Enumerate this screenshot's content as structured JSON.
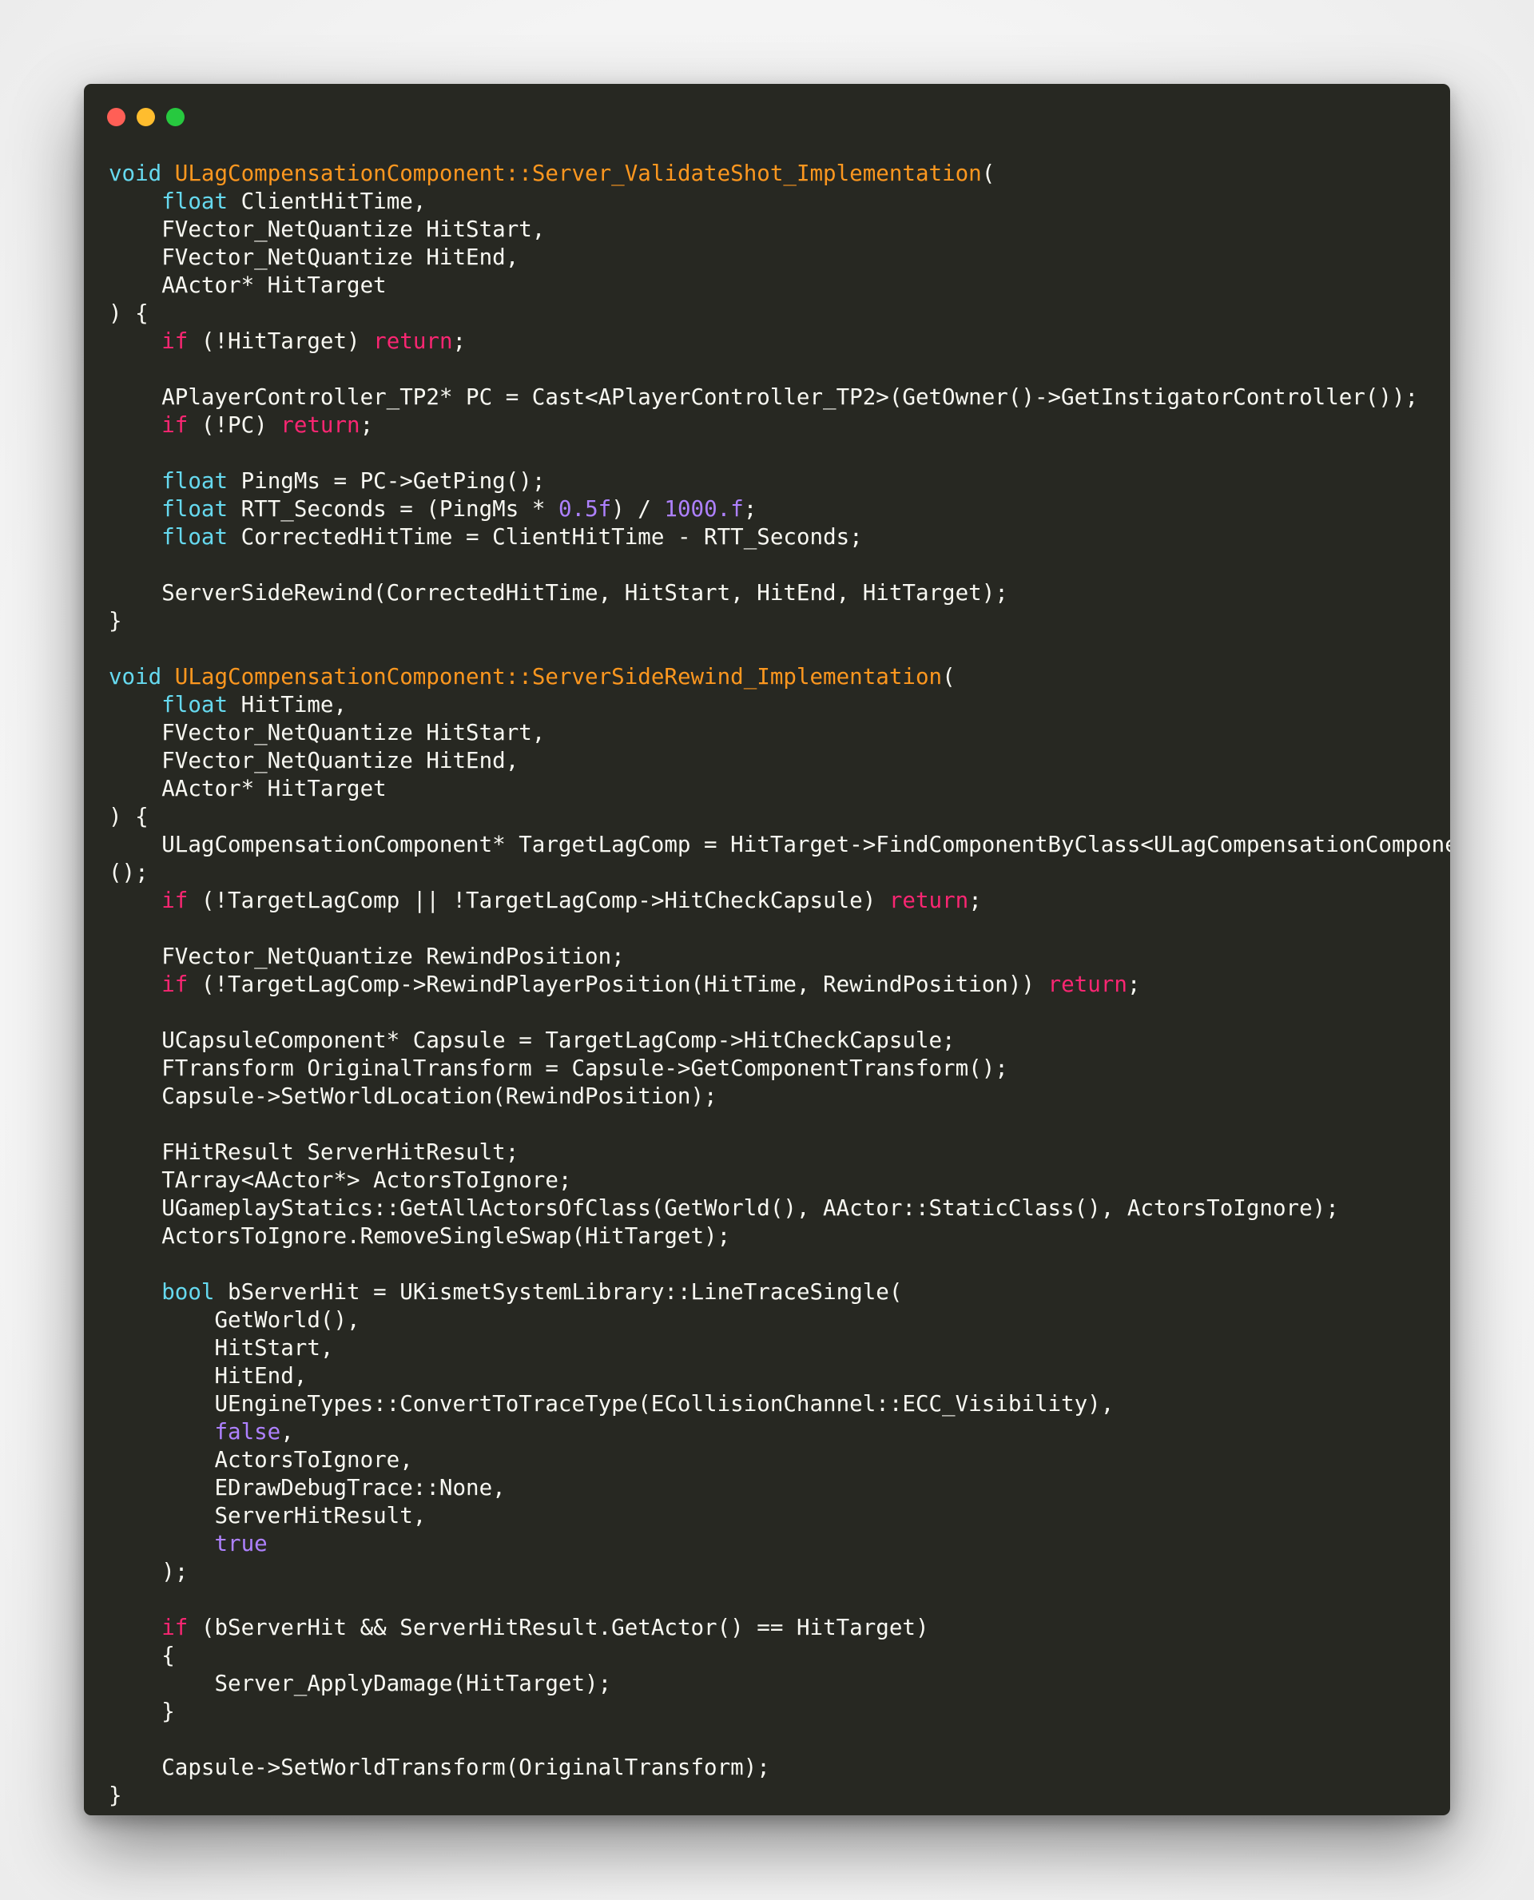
{
  "window": {
    "controls": [
      {
        "name": "close",
        "color": "#ff5f56"
      },
      {
        "name": "minimize",
        "color": "#ffbd2e"
      },
      {
        "name": "maximize",
        "color": "#27c93f"
      }
    ]
  },
  "theme": {
    "background": "#272822",
    "text": "#f8f8f2",
    "type": "#66d9ef",
    "control": "#f92672",
    "function": "#fd971f",
    "number": "#ae81ff"
  },
  "code": {
    "language": "cpp",
    "lines": [
      [
        [
          "type",
          "void"
        ],
        [
          "text",
          " "
        ],
        [
          "func",
          "ULagCompensationComponent::Server_ValidateShot_Implementation"
        ],
        [
          "text",
          "("
        ]
      ],
      [
        [
          "text",
          "    "
        ],
        [
          "type",
          "float"
        ],
        [
          "text",
          " ClientHitTime,"
        ]
      ],
      [
        [
          "text",
          "    FVector_NetQuantize HitStart,"
        ]
      ],
      [
        [
          "text",
          "    FVector_NetQuantize HitEnd,"
        ]
      ],
      [
        [
          "text",
          "    AActor* HitTarget"
        ]
      ],
      [
        [
          "text",
          ") {"
        ]
      ],
      [
        [
          "text",
          "    "
        ],
        [
          "ctrl",
          "if"
        ],
        [
          "text",
          " (!HitTarget) "
        ],
        [
          "ctrl",
          "return"
        ],
        [
          "text",
          ";"
        ]
      ],
      [],
      [
        [
          "text",
          "    APlayerController_TP2* PC = Cast<APlayerController_TP2>(GetOwner()->GetInstigatorController());"
        ]
      ],
      [
        [
          "text",
          "    "
        ],
        [
          "ctrl",
          "if"
        ],
        [
          "text",
          " (!PC) "
        ],
        [
          "ctrl",
          "return"
        ],
        [
          "text",
          ";"
        ]
      ],
      [],
      [
        [
          "text",
          "    "
        ],
        [
          "type",
          "float"
        ],
        [
          "text",
          " PingMs = PC->GetPing();"
        ]
      ],
      [
        [
          "text",
          "    "
        ],
        [
          "type",
          "float"
        ],
        [
          "text",
          " RTT_Seconds = (PingMs * "
        ],
        [
          "num",
          "0.5f"
        ],
        [
          "text",
          ") / "
        ],
        [
          "num",
          "1000.f"
        ],
        [
          "text",
          ";"
        ]
      ],
      [
        [
          "text",
          "    "
        ],
        [
          "type",
          "float"
        ],
        [
          "text",
          " CorrectedHitTime = ClientHitTime - RTT_Seconds;"
        ]
      ],
      [],
      [
        [
          "text",
          "    ServerSideRewind(CorrectedHitTime, HitStart, HitEnd, HitTarget);"
        ]
      ],
      [
        [
          "text",
          "}"
        ]
      ],
      [],
      [
        [
          "type",
          "void"
        ],
        [
          "text",
          " "
        ],
        [
          "func",
          "ULagCompensationComponent::ServerSideRewind_Implementation"
        ],
        [
          "text",
          "("
        ]
      ],
      [
        [
          "text",
          "    "
        ],
        [
          "type",
          "float"
        ],
        [
          "text",
          " HitTime,"
        ]
      ],
      [
        [
          "text",
          "    FVector_NetQuantize HitStart,"
        ]
      ],
      [
        [
          "text",
          "    FVector_NetQuantize HitEnd,"
        ]
      ],
      [
        [
          "text",
          "    AActor* HitTarget"
        ]
      ],
      [
        [
          "text",
          ") {"
        ]
      ],
      [
        [
          "text",
          "    ULagCompensationComponent* TargetLagComp = HitTarget->FindComponentByClass<ULagCompensationComponent>"
        ]
      ],
      [
        [
          "text",
          "();"
        ]
      ],
      [
        [
          "text",
          "    "
        ],
        [
          "ctrl",
          "if"
        ],
        [
          "text",
          " (!TargetLagComp || !TargetLagComp->HitCheckCapsule) "
        ],
        [
          "ctrl",
          "return"
        ],
        [
          "text",
          ";"
        ]
      ],
      [],
      [
        [
          "text",
          "    FVector_NetQuantize RewindPosition;"
        ]
      ],
      [
        [
          "text",
          "    "
        ],
        [
          "ctrl",
          "if"
        ],
        [
          "text",
          " (!TargetLagComp->RewindPlayerPosition(HitTime, RewindPosition)) "
        ],
        [
          "ctrl",
          "return"
        ],
        [
          "text",
          ";"
        ]
      ],
      [],
      [
        [
          "text",
          "    UCapsuleComponent* Capsule = TargetLagComp->HitCheckCapsule;"
        ]
      ],
      [
        [
          "text",
          "    FTransform OriginalTransform = Capsule->GetComponentTransform();"
        ]
      ],
      [
        [
          "text",
          "    Capsule->SetWorldLocation(RewindPosition);"
        ]
      ],
      [],
      [
        [
          "text",
          "    FHitResult ServerHitResult;"
        ]
      ],
      [
        [
          "text",
          "    TArray<AActor*> ActorsToIgnore;"
        ]
      ],
      [
        [
          "text",
          "    UGameplayStatics::GetAllActorsOfClass(GetWorld(), AActor::StaticClass(), ActorsToIgnore);"
        ]
      ],
      [
        [
          "text",
          "    ActorsToIgnore.RemoveSingleSwap(HitTarget);"
        ]
      ],
      [],
      [
        [
          "text",
          "    "
        ],
        [
          "type",
          "bool"
        ],
        [
          "text",
          " bServerHit = UKismetSystemLibrary::LineTraceSingle("
        ]
      ],
      [
        [
          "text",
          "        GetWorld(),"
        ]
      ],
      [
        [
          "text",
          "        HitStart,"
        ]
      ],
      [
        [
          "text",
          "        HitEnd,"
        ]
      ],
      [
        [
          "text",
          "        UEngineTypes::ConvertToTraceType(ECollisionChannel::ECC_Visibility),"
        ]
      ],
      [
        [
          "text",
          "        "
        ],
        [
          "num",
          "false"
        ],
        [
          "text",
          ","
        ]
      ],
      [
        [
          "text",
          "        ActorsToIgnore,"
        ]
      ],
      [
        [
          "text",
          "        EDrawDebugTrace::None,"
        ]
      ],
      [
        [
          "text",
          "        ServerHitResult,"
        ]
      ],
      [
        [
          "text",
          "        "
        ],
        [
          "num",
          "true"
        ]
      ],
      [
        [
          "text",
          "    );"
        ]
      ],
      [],
      [
        [
          "text",
          "    "
        ],
        [
          "ctrl",
          "if"
        ],
        [
          "text",
          " (bServerHit && ServerHitResult.GetActor() == HitTarget)"
        ]
      ],
      [
        [
          "text",
          "    {"
        ]
      ],
      [
        [
          "text",
          "        Server_ApplyDamage(HitTarget);"
        ]
      ],
      [
        [
          "text",
          "    }"
        ]
      ],
      [],
      [
        [
          "text",
          "    Capsule->SetWorldTransform(OriginalTransform);"
        ]
      ],
      [
        [
          "text",
          "}"
        ]
      ]
    ]
  }
}
